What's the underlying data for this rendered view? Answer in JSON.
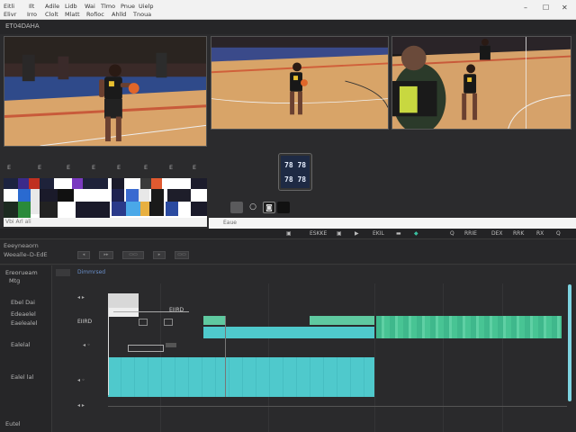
{
  "menubar": {
    "row1": [
      "Eitli",
      "Ilt",
      "Adile",
      "Lidb",
      "Wai",
      "Tlmo",
      "Pnue",
      "Uielp"
    ],
    "row2": [
      "Elivr",
      "Irro",
      "Clolt",
      "Mlatt",
      "Rofioc",
      "Ahlld",
      "Tnoua"
    ],
    "win_min": "–",
    "win_max": "☐",
    "win_close": "✕"
  },
  "titlebar": {
    "project": "ET04DAHA"
  },
  "bin": {
    "headers": [
      "E",
      "E",
      "E",
      "E",
      "E",
      "E",
      "E",
      "E"
    ],
    "footer": "Vbi Arl ali"
  },
  "scoreboard": {
    "top": "78 78",
    "bottom": "78 78"
  },
  "viewer_bar": {
    "label": "Eaue"
  },
  "transport": {
    "items": [
      "▣",
      "ESKKE",
      "▣",
      "▶",
      "EKIL",
      "▬",
      "◆",
      "Q",
      "RRIE",
      "DEX",
      "RRK",
      "RX",
      "Q"
    ]
  },
  "panel": {
    "line1": "Eeeyneaorn",
    "line2": "Weealle–D-EdE"
  },
  "tools": [
    "◂",
    "▸▸",
    "▭▭",
    "▸",
    "▭▭"
  ],
  "timeline": {
    "header_left": "Ereorueam",
    "header_sub": "Mtg",
    "ruler": "Dimmrsed",
    "tracks": [
      "Ebel Dai",
      "Edeaelel",
      "Eaelealel",
      "Ealelal",
      "Ealel lal"
    ],
    "footer": "Eutel",
    "clip_label": "EIIRD",
    "marker_a": "◂ ▸",
    "marker_b": "◂ ◦"
  },
  "colors": {
    "teal": "#4fc9cc",
    "green": "#5fd0a4",
    "accent_blue": "#6a8fc9"
  }
}
